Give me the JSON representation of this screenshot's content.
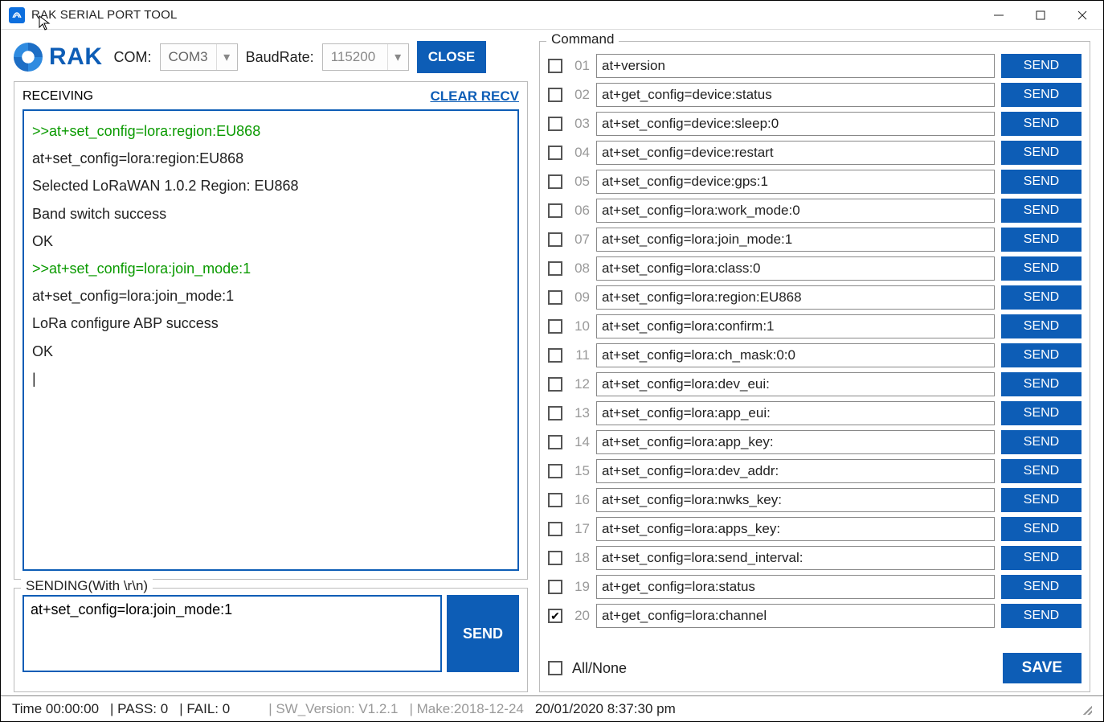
{
  "window": {
    "title": "RAK SERIAL PORT TOOL"
  },
  "logo": {
    "text": "RAK"
  },
  "connection": {
    "com_label": "COM:",
    "com_value": "COM3",
    "baud_label": "BaudRate:",
    "baud_value": "115200",
    "close_label": "CLOSE"
  },
  "receiving": {
    "legend": "RECEIVING",
    "clear_label": "CLEAR RECV",
    "lines": [
      {
        "cls": "cmd",
        "text": ">>at+set_config=lora:region:EU868"
      },
      {
        "cls": "echo",
        "text": "at+set_config=lora:region:EU868"
      },
      {
        "cls": "out",
        "text": "Selected LoRaWAN 1.0.2 Region: EU868"
      },
      {
        "cls": "out",
        "text": "Band switch success"
      },
      {
        "cls": "out",
        "text": "OK"
      },
      {
        "cls": "cmd",
        "text": ">>at+set_config=lora:join_mode:1"
      },
      {
        "cls": "echo",
        "text": "at+set_config=lora:join_mode:1"
      },
      {
        "cls": "out",
        "text": "LoRa configure ABP success"
      },
      {
        "cls": "out",
        "text": "OK"
      }
    ]
  },
  "sending": {
    "legend": "SENDING(With \\r\\n)",
    "value": "at+set_config=lora:join_mode:1",
    "send_label": "SEND"
  },
  "commands": {
    "legend": "Command",
    "send_label": "SEND",
    "all_none_label": "All/None",
    "save_label": "SAVE",
    "all_none_checked": false,
    "rows": [
      {
        "n": "01",
        "checked": false,
        "cmd": "at+version"
      },
      {
        "n": "02",
        "checked": false,
        "cmd": "at+get_config=device:status"
      },
      {
        "n": "03",
        "checked": false,
        "cmd": "at+set_config=device:sleep:0"
      },
      {
        "n": "04",
        "checked": false,
        "cmd": "at+set_config=device:restart"
      },
      {
        "n": "05",
        "checked": false,
        "cmd": "at+set_config=device:gps:1"
      },
      {
        "n": "06",
        "checked": false,
        "cmd": "at+set_config=lora:work_mode:0"
      },
      {
        "n": "07",
        "checked": false,
        "cmd": "at+set_config=lora:join_mode:1"
      },
      {
        "n": "08",
        "checked": false,
        "cmd": "at+set_config=lora:class:0"
      },
      {
        "n": "09",
        "checked": false,
        "cmd": "at+set_config=lora:region:EU868"
      },
      {
        "n": "10",
        "checked": false,
        "cmd": "at+set_config=lora:confirm:1"
      },
      {
        "n": "11",
        "checked": false,
        "cmd": "at+set_config=lora:ch_mask:0:0"
      },
      {
        "n": "12",
        "checked": false,
        "cmd": "at+set_config=lora:dev_eui:"
      },
      {
        "n": "13",
        "checked": false,
        "cmd": "at+set_config=lora:app_eui:"
      },
      {
        "n": "14",
        "checked": false,
        "cmd": "at+set_config=lora:app_key:"
      },
      {
        "n": "15",
        "checked": false,
        "cmd": "at+set_config=lora:dev_addr:"
      },
      {
        "n": "16",
        "checked": false,
        "cmd": "at+set_config=lora:nwks_key:"
      },
      {
        "n": "17",
        "checked": false,
        "cmd": "at+set_config=lora:apps_key:"
      },
      {
        "n": "18",
        "checked": false,
        "cmd": "at+set_config=lora:send_interval:"
      },
      {
        "n": "19",
        "checked": false,
        "cmd": "at+get_config=lora:status"
      },
      {
        "n": "20",
        "checked": true,
        "cmd": "at+get_config=lora:channel"
      }
    ]
  },
  "status": {
    "time": "Time  00:00:00",
    "pass": "| PASS:  0",
    "fail": "| FAIL:  0",
    "sw": "| SW_Version:  V1.2.1",
    "make": "| Make:2018-12-24",
    "clock": "20/01/2020 8:37:30 pm"
  }
}
